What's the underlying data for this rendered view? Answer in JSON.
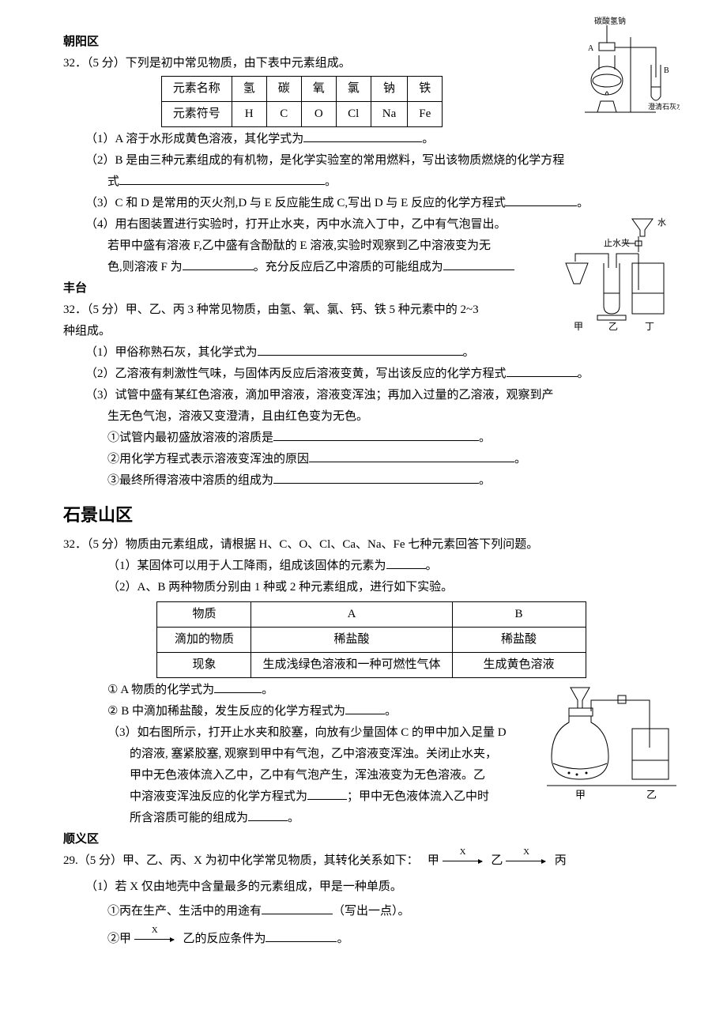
{
  "chaoyang": {
    "title": "朝阳区",
    "q_no": "32．（5 分）下列是初中常见物质，由下表中元素组成。",
    "table": {
      "row1": [
        "元素名称",
        "氢",
        "碳",
        "氧",
        "氯",
        "钠",
        "铁"
      ],
      "row2": [
        "元素符号",
        "H",
        "C",
        "O",
        "Cl",
        "Na",
        "Fe"
      ]
    },
    "p1": "（1）A 溶于水形成黄色溶液，其化学式为",
    "p1_end": "。",
    "p2a": "（2）B 是由三种元素组成的有机物，是化学实验室的常用燃料，写出该物质燃烧的化学方程",
    "p2b": "式",
    "p2_end": "。",
    "p3": "（3）C 和 D 是常用的灭火剂,D 与 E 反应能生成 C,写出 D 与 E 反应的化学方程式",
    "p3_end": "。",
    "p4a": "（4）用右图装置进行实验时，打开止水夹，丙中水流入丁中，乙中有气泡冒出。",
    "p4b": "若甲中盛有溶液 F,乙中盛有含酚酞的 E 溶液,实验时观察到乙中溶液变为无",
    "p4c_a": "色,则溶液 F 为",
    "p4c_b": "。充分反应后乙中溶质的可能组成为",
    "fig1": {
      "label_top": "碳酸氢钠",
      "label_a": "A",
      "label_b": "B",
      "label_bottom": "澄清石灰水"
    },
    "fig2": {
      "water": "水",
      "clip": "止水夹",
      "jia": "甲",
      "yi": "乙",
      "ding": "丁"
    }
  },
  "fengtai": {
    "title": "丰台",
    "q_no_a": "32．（5 分）甲、乙、丙 3 种常见物质，由氢、氧、氯、钙、铁 5 种元素中的 2~3",
    "q_no_b": "种组成。",
    "p1": "（1）甲俗称熟石灰，其化学式为",
    "p1_end": "。",
    "p2": "（2）乙溶液有刺激性气味，与固体丙反应后溶液变黄，写出该反应的化学方程式",
    "p2_end": "。",
    "p3a": "（3）试管中盛有某红色溶液，滴加甲溶液，溶液变浑浊；再加入过量的乙溶液，观察到产",
    "p3b": "生无色气泡，溶液又变澄清，且由红色变为无色。",
    "p3c": "①试管内最初盛放溶液的溶质是",
    "p3c_end": "。",
    "p3d": "②用化学方程式表示溶液变浑浊的原因",
    "p3d_end": "。",
    "p3e": "③最终所得溶液中溶质的组成为",
    "p3e_end": "。"
  },
  "shijingshan": {
    "title": "石景山区",
    "q_no": "32．（5 分）物质由元素组成，请根据 H、C、O、Cl、Ca、Na、Fe 七种元素回答下列问题。",
    "p1": "（1）某固体可以用于人工降雨，组成该固体的元素为",
    "p1_end": "。",
    "p2": "（2）A、B 两种物质分别由 1 种或 2 种元素组成，进行如下实验。",
    "table": {
      "h1": "物质",
      "h2": "A",
      "h3": "B",
      "r1c1": "滴加的物质",
      "r1c2": "稀盐酸",
      "r1c3": "稀盐酸",
      "r2c1": "现象",
      "r2c2": "生成浅绿色溶液和一种可燃性气体",
      "r2c3": "生成黄色溶液"
    },
    "p2a": "① A 物质的化学式为",
    "p2a_end": "。",
    "p2b": "② B 中滴加稀盐酸，发生反应的化学方程式为",
    "p2b_end": "。",
    "p3a": "（3）如右图所示，打开止水夹和胶塞，向放有少量固体 C 的甲中加入足量 D",
    "p3b": "的溶液, 塞紧胶塞, 观察到甲中有气泡，乙中溶液变浑浊。关闭止水夹，",
    "p3c": "甲中无色液体流入乙中，乙中有气泡产生，浑浊液变为无色溶液。乙",
    "p3d_a": "中溶液变浑浊反应的化学方程式为",
    "p3d_b": "；甲中无色液体流入乙中时",
    "p3e": "所含溶质可能的组成为",
    "p3e_end": "。",
    "fig": {
      "jia": "甲",
      "yi": "乙"
    }
  },
  "shunyi": {
    "title": "顺义区",
    "q_no_a": "29.（5 分）甲、乙、丙、X 为初中化学常见物质，其转化关系如下：",
    "rel_jia": "甲",
    "rel_yi": "乙",
    "rel_bing": "丙",
    "rel_x": "X",
    "p1": "（1）若 X 仅由地壳中含量最多的元素组成，甲是一种单质。",
    "p1a": "①丙在生产、生活中的用途有",
    "p1a_end": "（写出一点）。",
    "p1b_a": "②甲",
    "p1b_b": "乙的反应条件为",
    "p1b_end": "。"
  }
}
